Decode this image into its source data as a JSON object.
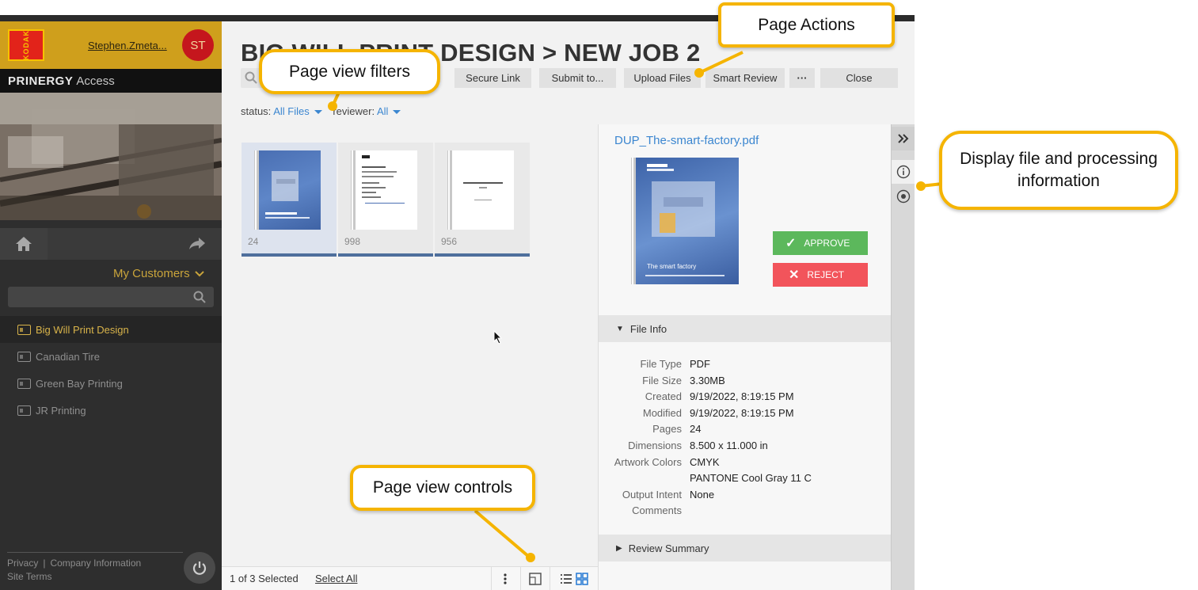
{
  "sidebar": {
    "logo_text": "KODAK",
    "user": "Stephen.Zmeta...",
    "avatar_initials": "ST",
    "product_name": "PRINERGY",
    "product_sub": "Access",
    "customers_label": "My Customers",
    "customers": [
      {
        "label": "Big Will Print Design",
        "active": true
      },
      {
        "label": "Canadian Tire",
        "active": false
      },
      {
        "label": "Green Bay Printing",
        "active": false
      },
      {
        "label": "JR Printing",
        "active": false
      }
    ],
    "footer": {
      "privacy": "Privacy",
      "company": "Company Information",
      "terms": "Site Terms"
    }
  },
  "main": {
    "title": "BIG WILL PRINT DESIGN > NEW JOB 2",
    "actions": {
      "secure_link": "Secure Link",
      "submit": "Submit to...",
      "upload": "Upload Files",
      "smart_review": "Smart Review",
      "more": "···",
      "close": "Close"
    },
    "filters": {
      "status_label": "status:",
      "status_value": "All Files",
      "reviewer_label": "reviewer:",
      "reviewer_value": "All"
    },
    "thumbnails": [
      {
        "pages": "24",
        "selected": true
      },
      {
        "pages": "998",
        "selected": false
      },
      {
        "pages": "956",
        "selected": false
      }
    ],
    "bottom": {
      "count": "1 of 3 Selected",
      "select_all": "Select All"
    }
  },
  "details": {
    "filename": "DUP_The-smart-factory.pdf",
    "approve": "APPROVE",
    "reject": "REJECT",
    "file_info_title": "File Info",
    "file_info": [
      {
        "label": "File Type",
        "value": "PDF"
      },
      {
        "label": "File Size",
        "value": "3.30MB"
      },
      {
        "label": "Created",
        "value": "9/19/2022, 8:19:15 PM"
      },
      {
        "label": "Modified",
        "value": "9/19/2022, 8:19:15 PM"
      },
      {
        "label": "Pages",
        "value": "24"
      },
      {
        "label": "Dimensions",
        "value": "8.500 x 11.000 in"
      },
      {
        "label": "Artwork Colors",
        "value": "CMYK"
      },
      {
        "label": "",
        "value": "PANTONE Cool Gray 11 C"
      },
      {
        "label": "Output Intent",
        "value": "None"
      },
      {
        "label": "Comments",
        "value": ""
      }
    ],
    "review_summary_title": "Review Summary",
    "cover_title": "The smart factory"
  },
  "callouts": {
    "page_actions": "Page Actions",
    "page_view_filters": "Page view filters",
    "display_info": "Display file and processing information",
    "page_view_controls": "Page view controls"
  },
  "colors": {
    "accent": "#f5b400",
    "brand": "#cf9f1c",
    "link": "#3b86d0",
    "approve": "#5cb85c",
    "reject": "#f2545b"
  }
}
